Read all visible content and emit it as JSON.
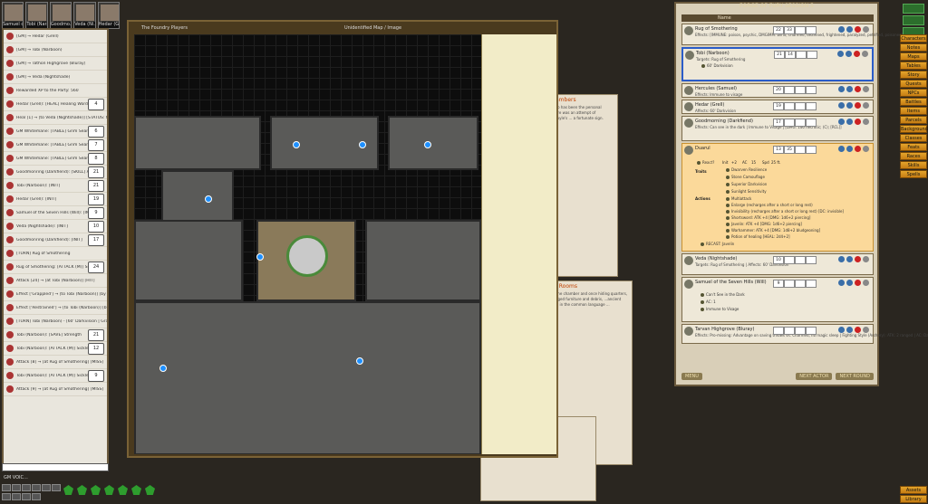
{
  "portraits": [
    {
      "name": "Samuel o..."
    },
    {
      "name": "Tobi (Nar..."
    },
    {
      "name": "Goodmo..."
    },
    {
      "name": "Veda (Ni..."
    },
    {
      "name": "Hedar (Gr..."
    }
  ],
  "chat": {
    "lines": [
      {
        "text": "[GM] → Hedar (Grell)",
        "roll": ""
      },
      {
        "text": "[GM] → Tobi (Narboon)",
        "roll": ""
      },
      {
        "text": "[GM] → Tathon Highgrove (Bluray)",
        "roll": ""
      },
      {
        "text": "[GM] → Veda (Nightshade)",
        "roll": ""
      },
      {
        "text": "Rewarded XP to the Party: 560",
        "roll": ""
      },
      {
        "text": "Hedar (Grell): [HEAL] Healing Word",
        "roll": "4"
      },
      {
        "text": "Heal [1] → [to Veda (Nightshade)] [STATUS: Moderate]",
        "roll": ""
      },
      {
        "text": "GM Whitemane: [TABLE] Grim Search",
        "roll": "6"
      },
      {
        "text": "GM Whitemane: [TABLE] Grim Search",
        "roll": "7"
      },
      {
        "text": "GM Whitemane: [TABLE] Grim Search",
        "roll": "8"
      },
      {
        "text": "Goodmonring (Darkfiend): [SKILL] Arcana [PROF]",
        "roll": "21"
      },
      {
        "text": "Tobi (Narboon): [INIT]",
        "roll": "21"
      },
      {
        "text": "Hedar (Grell): [INIT]",
        "roll": "19"
      },
      {
        "text": "Samuel of the Seven Hills (Will): [INIT]",
        "roll": "9"
      },
      {
        "text": "Veda (Nightshade): [INIT]",
        "roll": "10"
      },
      {
        "text": "Goodmonring (Darkfiend): [INIT]",
        "roll": "17"
      },
      {
        "text": "[TURN] Rug of Smothering",
        "roll": ""
      },
      {
        "text": "Rug of Smothering: [ATTACK (M)] Smother",
        "roll": "24"
      },
      {
        "text": "Attack [24] → [at Tobi (Narboon)] [HIT]",
        "roll": ""
      },
      {
        "text": "Effect ['Grappled'] → [to Tobi (Narboon)] [by Rug of Smothering]",
        "roll": ""
      },
      {
        "text": "Effect ['Restrained'] → [to Tobi (Narboon)] [by Rug of Smothering]",
        "roll": ""
      },
      {
        "text": "[TURN] Tobi (Narboon) - [60' Darkvision | Grappled | Restrained]",
        "roll": ""
      },
      {
        "text": "Tobi (Narboon): [SAVE] Strength",
        "roll": "21"
      },
      {
        "text": "Tobi (Narboon): [ATTACK (M)] Sickle",
        "roll": "12"
      },
      {
        "text": "Attack [8] → [at Rug of Smothering] [MISS]",
        "roll": ""
      },
      {
        "text": "Tobi (Narboon): [ATTACK (M)] Sickle",
        "roll": "9"
      },
      {
        "text": "Attack [9] → [at Rug of Smothering] [MISS]",
        "roll": ""
      }
    ],
    "input_value": "",
    "mode_label": "GM VOIC..."
  },
  "map": {
    "window_title": "The Foundry Players",
    "image_title": "Unidentified Map / Image"
  },
  "story": {
    "panel1_heading": "Chambers",
    "panel1_text": "...emo has been the personal ...there was an attempt of Gargoyle's ... a fortunate sign.",
    "panel2_heading": "ted Rooms",
    "panel2_text": "...in the chamber and once hiding quarters, ...ranged furniture and debris, ...ancient runes in the common language ..."
  },
  "combat": {
    "title": "FORGE OF FURY SESSION 5",
    "header_name": "Name",
    "round": "",
    "rows": [
      {
        "name": "Rug of Smothering",
        "sub": "Effects: [IMMUNE: poison, psychic, DMGIMM: blind, charmed, deafened, frightened, paralyzed, petrified, poisoned]",
        "init": "22",
        "hp": "33",
        "tmp": "",
        "wounds": ""
      },
      {
        "name": "Tobi (Narboon)",
        "sub": "Targets: Rug of Smothering",
        "init": "21",
        "hp": "14",
        "tmp": "",
        "wounds": "",
        "effects": [
          "60' Darkvision"
        ]
      },
      {
        "name": "Hercules (Samuel)",
        "sub": "Effects: Immune to visage",
        "init": "20",
        "hp": "",
        "tmp": "",
        "wounds": ""
      },
      {
        "name": "Hedar (Grell)",
        "sub": "Affects: 60' Darkvision",
        "init": "19",
        "hp": "",
        "tmp": "",
        "wounds": ""
      },
      {
        "name": "Goodmorning (Darkfiend)",
        "sub": "Effects: Can see in the dark | Immune to Visage | [DMG: 1d6 necrotic; (C); [RCL]]",
        "init": "17",
        "hp": "",
        "tmp": "",
        "wounds": ""
      },
      {
        "name": "Duarul",
        "sub": "",
        "init": "13",
        "hp": "35",
        "tmp": "",
        "wounds": ""
      },
      {
        "name": "Veda (Nightshade)",
        "sub": "Targets: Rug of Smothering | Affects: 60' Darkvision",
        "init": "10",
        "hp": "",
        "tmp": "",
        "wounds": ""
      },
      {
        "name": "Samuel of the Seven Hills (Will)",
        "sub": "",
        "init": "9",
        "hp": "",
        "tmp": "",
        "wounds": "",
        "effects": [
          "Can't See in the Dark",
          "AC: 1",
          "Immune to Visage"
        ]
      },
      {
        "name": "Tarvan Highgrove (Bluray)",
        "sub": "Effects: Pro-missing: Advantage on saving throws vs. Charmed, no magic sleep | Fighting Style (Archery): ATK: 2 ranged | AC: Darkvision",
        "init": "",
        "hp": "",
        "tmp": "",
        "wounds": ""
      }
    ],
    "duarul": {
      "react_label": "React?",
      "init_label": "Init",
      "init_value": "+2",
      "ac_label": "AC",
      "ac_value": "15",
      "spd_label": "Spd",
      "spd_value": "25 ft.",
      "traits_label": "Traits",
      "actions_label": "Actions",
      "traits": [
        "Dwarven Resilience",
        "Stone Camouflage",
        "Superior Darkvision",
        "Sunlight Sensitivity"
      ],
      "actions": [
        "Multiattack",
        "Enlarge (recharges after a short or long rest)",
        "Invisibility (recharges after a short or long rest) [DC: invisible]",
        "Shortsword: ATK +4 [DMG: 1d6+2 piercing]",
        "Javelin: ATK +4 [DMG: 1d6+2 piercing]",
        "Warhammer: ATK +4 [DMG: 1d8+2 bludgeoning]",
        "Potion of healing [HEAL: 2d4+2]"
      ],
      "recast": "RECAST: Javelin"
    },
    "footer": {
      "menu": "MENU",
      "nextactor": "NEXT ACTOR",
      "nextround": "NEXT ROUND"
    }
  },
  "sidebar": {
    "buttons": [
      "Characters",
      "Notes",
      "Maps",
      "Tables",
      "Story",
      "Quests",
      "NPCs",
      "Battles",
      "Items",
      "Parcels",
      "Backgrounds",
      "Classes",
      "Feats",
      "Races",
      "Skills",
      "Spells"
    ],
    "bottom_buttons": [
      "Assets",
      "Library"
    ]
  }
}
